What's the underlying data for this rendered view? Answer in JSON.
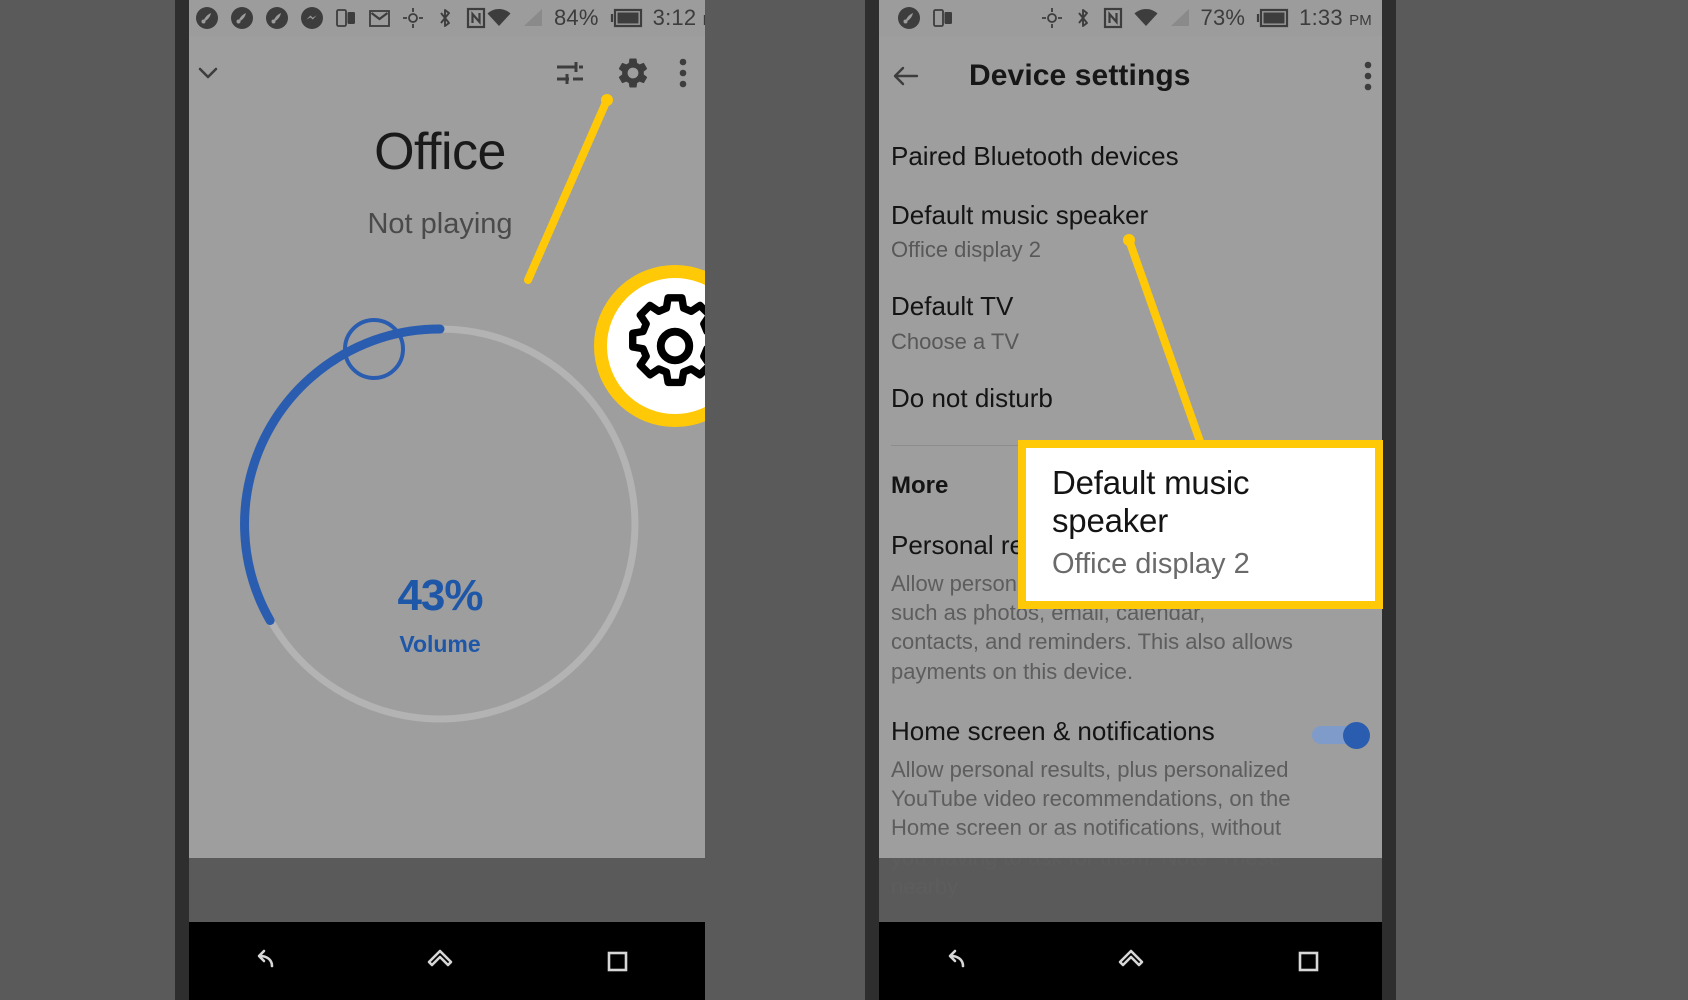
{
  "background_color": "#5a5a5a",
  "accent_color": "#ffc907",
  "left_phone": {
    "status_bar": {
      "battery_percent": "84%",
      "time": "3:12",
      "ampm": "PM",
      "left_icons": [
        "app-badge-icon",
        "app-badge-icon",
        "app-badge-icon",
        "messenger-icon",
        "split-screen-icon",
        "gmail-icon",
        "location-icon",
        "bluetooth-icon",
        "nfc-icon"
      ],
      "right_icons": [
        "wifi-icon",
        "cellular-signal-icon",
        "battery-icon"
      ]
    },
    "toolbar": {
      "collapse_icon": "chevron-down-icon",
      "tune_icon": "equalizer-icon",
      "settings_icon": "gear-icon",
      "overflow_icon": "more-vertical-icon"
    },
    "device_name": "Office",
    "playback_status": "Not playing",
    "volume": {
      "value_label": "43%",
      "caption": "Volume",
      "percent": 43,
      "arc_color": "#2a5db0",
      "track_color": "#b0b0b0"
    },
    "highlight": {
      "target": "gear-icon",
      "shape": "circle-callout"
    },
    "nav_bar": {
      "back": "back-icon",
      "home": "home-icon",
      "recents": "recents-icon"
    }
  },
  "right_phone": {
    "status_bar": {
      "battery_percent": "73%",
      "time": "1:33",
      "ampm": "PM",
      "left_icons": [
        "app-badge-icon",
        "split-screen-icon"
      ],
      "right_icons": [
        "location-icon",
        "bluetooth-icon",
        "nfc-icon",
        "wifi-icon",
        "cellular-signal-icon",
        "battery-icon"
      ]
    },
    "toolbar": {
      "back_icon": "arrow-back-icon",
      "title": "Device settings",
      "overflow_icon": "more-vertical-icon"
    },
    "settings": [
      {
        "title": "Paired Bluetooth devices",
        "subtitle": ""
      },
      {
        "title": "Default music speaker",
        "subtitle": "Office display 2"
      },
      {
        "title": "Default TV",
        "subtitle": "Choose a TV"
      },
      {
        "title": "Do not disturb",
        "subtitle": ""
      }
    ],
    "section_header": "More",
    "toggles": [
      {
        "title": "Personal results",
        "subtitle": "Allow personal results on this device, such as photos, email, calendar, contacts, and reminders. This also allows payments on this device.",
        "state": "on"
      },
      {
        "title": "Home screen & notifications",
        "subtitle": "Allow personal results, plus personalized YouTube video recommendations, on the Home screen or as notifications, without you having to ask for them. Note: These nearby",
        "state": "on"
      }
    ],
    "callout": {
      "title": "Default music speaker",
      "subtitle": "Office display 2"
    },
    "nav_bar": {
      "back": "back-icon",
      "home": "home-icon",
      "recents": "recents-icon"
    }
  }
}
